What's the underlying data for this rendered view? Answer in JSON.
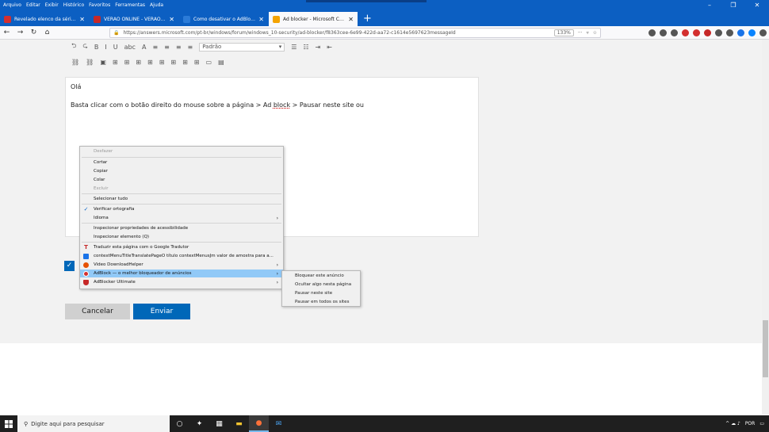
{
  "menubar": [
    "Arquivo",
    "Editar",
    "Exibir",
    "Histórico",
    "Favoritos",
    "Ferramentas",
    "Ajuda"
  ],
  "window_controls": [
    "–",
    "❐",
    "✕"
  ],
  "tabs": [
    {
      "label": "Revelado elenco da série live a",
      "favicon_color": "#d32f2f",
      "active": false
    },
    {
      "label": "VERÃO ONLINE - VERÃO ONLINE",
      "favicon_color": "#c62828",
      "active": false
    },
    {
      "label": "Como desativar o AdBlock - mi",
      "favicon_color": "#2b7bd8",
      "active": false
    },
    {
      "label": "Ad blocker - Microsoft Commu",
      "favicon_color": "#f4a300",
      "active": true
    }
  ],
  "nav": {
    "url": "https://answers.microsoft.com/pt-br/windows/forum/windows_10-security/ad-blocker/f8363cee-6e99-422d-aa72-c1614e5697623messageId",
    "zoom": "133%"
  },
  "extension_colors": [
    "#555",
    "#555",
    "#555",
    "#d32f2f",
    "#d32f2f",
    "#c62828",
    "#555",
    "#555",
    "#1a73e8",
    "#0a84ff",
    "#555"
  ],
  "toolbar": {
    "row1": [
      "⮌",
      "⮎",
      "B",
      "I",
      "U",
      "abc",
      "A",
      "≡",
      "≡",
      "≡",
      "≡"
    ],
    "font_select": "Padrão",
    "row1b": [
      "☰",
      "☷",
      "⇥",
      "⇤"
    ],
    "row2": [
      "⛓",
      "⛓",
      "▣",
      "⊞",
      "⊞",
      "⊞",
      "⊞",
      "⊞",
      "⊞",
      "⊞",
      "⊞",
      "▭",
      "▤"
    ]
  },
  "editor": {
    "greeting": "Olá",
    "line_a": "Basta clicar com o botão direito do mouse sobre a página  > Ad ",
    "line_word": "block",
    "line_b": "  > Pausar neste site ou"
  },
  "checkbox_mark": "✓",
  "buttons": {
    "cancel": "Cancelar",
    "send": "Enviar"
  },
  "context_menu": {
    "items": [
      {
        "label": "Desfazer",
        "disabled": true
      },
      {
        "label": "Cortar"
      },
      {
        "label": "Copiar"
      },
      {
        "label": "Colar"
      },
      {
        "label": "Excluir",
        "disabled": true
      },
      {
        "label": "Selecionar tudo"
      },
      {
        "label": "Verificar ortografia",
        "check": "✓"
      },
      {
        "label": "Idioma",
        "arrow": "›"
      },
      {
        "label": "Inspecionar propriedades de acessibilidade"
      },
      {
        "label": "Inspecionar elemento (Q)"
      },
      {
        "label": "Traduzir esta página com o Google Tradutor",
        "icon": "T"
      },
      {
        "label": "contextMenuTitleTranslatePageO título contextMenusJm valor de amostra para a..."
      },
      {
        "label": "Video DownloadHelper",
        "arrow": "›"
      },
      {
        "label": "AdBlock — o melhor bloqueador de anúncios",
        "arrow": "›",
        "highlight": true
      },
      {
        "label": "AdBlocker Ultimate",
        "arrow": "›"
      }
    ]
  },
  "submenu": [
    "Bloquear este anúncio",
    "Ocultar algo nesta página",
    "Pausar neste site",
    "Pausar em todos os sites"
  ],
  "taskbar": {
    "search_placeholder": "Digite aqui para pesquisar",
    "tray_lang": "POR",
    "tray_arrows": "^ ☁ ♪"
  }
}
